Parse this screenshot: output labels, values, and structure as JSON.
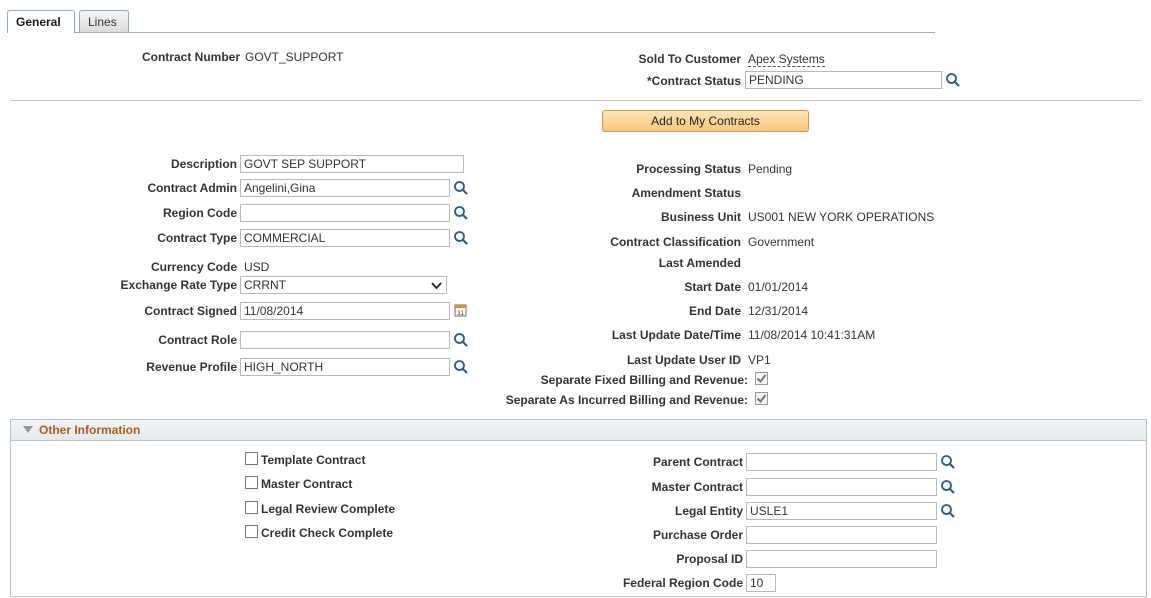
{
  "tabs": [
    {
      "label": "General",
      "active": true
    },
    {
      "label": "Lines",
      "active": false
    }
  ],
  "header": {
    "contract_number_label": "Contract Number",
    "contract_number": "GOVT_SUPPORT",
    "sold_to_label": "Sold To Customer",
    "sold_to": "Apex Systems",
    "status_label": "*Contract Status",
    "status": "PENDING"
  },
  "add_button_label": "Add to My Contracts",
  "left": {
    "description_label": "Description",
    "description": "GOVT SEP SUPPORT",
    "admin_label": "Contract Admin",
    "admin": "Angelini,Gina",
    "region_label": "Region Code",
    "region": "",
    "type_label": "Contract Type",
    "type": "COMMERCIAL",
    "currency_label": "Currency Code",
    "currency": "USD",
    "rate_type_label": "Exchange Rate Type",
    "rate_type": "CRRNT",
    "signed_label": "Contract Signed",
    "signed": "11/08/2014",
    "role_label": "Contract Role",
    "role": "",
    "revenue_label": "Revenue Profile",
    "revenue": "HIGH_NORTH"
  },
  "right": {
    "processing_label": "Processing Status",
    "processing": "Pending",
    "amendment_label": "Amendment Status",
    "amendment": "",
    "bu_label": "Business Unit",
    "bu": "US001 NEW YORK OPERATIONS",
    "classification_label": "Contract Classification",
    "classification": "Government",
    "last_amended_label": "Last Amended",
    "last_amended": "",
    "start_label": "Start Date",
    "start": "01/01/2014",
    "end_label": "End Date",
    "end": "12/31/2014",
    "updated_label": "Last Update Date/Time",
    "updated": "11/08/2014 10:41:31AM",
    "user_label": "Last Update User ID",
    "user": "VP1",
    "sep_fixed_label": "Separate Fixed Billing and Revenue:",
    "sep_fixed": true,
    "sep_incurred_label": "Separate As Incurred Billing and Revenue:",
    "sep_incurred": true
  },
  "other": {
    "title": "Other Information",
    "checks": [
      {
        "label": "Template Contract",
        "checked": false
      },
      {
        "label": "Master Contract",
        "checked": false
      },
      {
        "label": "Legal Review Complete",
        "checked": false
      },
      {
        "label": "Credit Check Complete",
        "checked": false
      }
    ],
    "parent_label": "Parent Contract",
    "parent": "",
    "master_label": "Master Contract",
    "master": "",
    "legal_label": "Legal Entity",
    "legal": "USLE1",
    "po_label": "Purchase Order",
    "po": "",
    "proposal_label": "Proposal ID",
    "proposal": "",
    "federal_label": "Federal Region Code",
    "federal": "10"
  }
}
